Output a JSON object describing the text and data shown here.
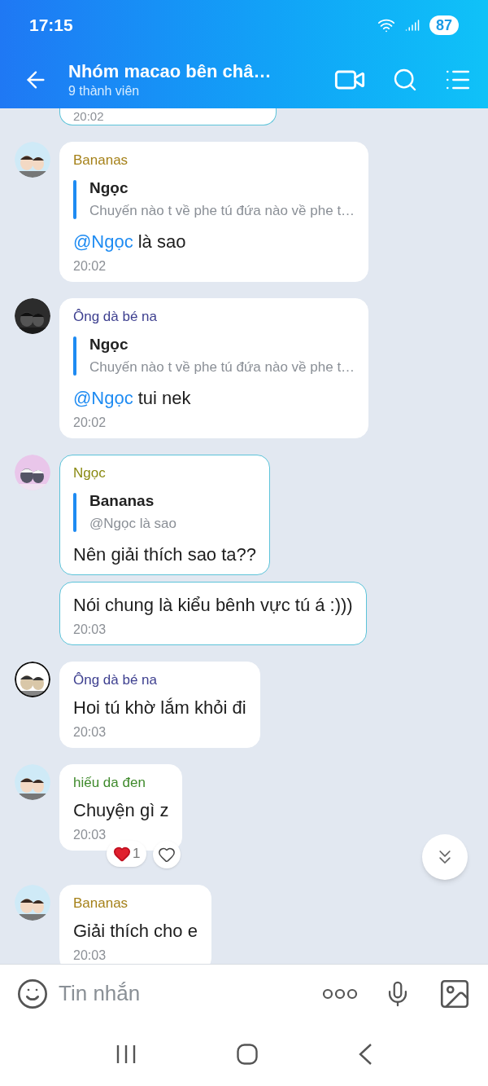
{
  "status_bar": {
    "time": "17:15",
    "battery": "87"
  },
  "header": {
    "title": "Nhóm macao bên châ…",
    "subtitle": "9 thành viên"
  },
  "top_bubble": {
    "time": "20:02"
  },
  "messages": [
    {
      "sender": "Bananas",
      "color": "#a58119",
      "quote": {
        "author": "Ngọc",
        "text": "Chuyến nào t về phe tú đứa nào về phe t…"
      },
      "mention": "@Ngọc",
      "text": "là sao",
      "time": "20:02",
      "highlighted": false
    },
    {
      "sender": "Ông dà bé na",
      "color": "#3d3f8f",
      "quote": {
        "author": "Ngọc",
        "text": "Chuyến nào t về phe tú đứa nào về phe t…"
      },
      "mention": "@Ngọc",
      "text": "tui nek",
      "time": "20:02",
      "highlighted": false
    },
    {
      "sender": "Ngọc",
      "color": "#8a8a12",
      "quote": {
        "author": "Bananas",
        "text": "@Ngọc là sao"
      },
      "text": "Nên giải thích sao ta??",
      "highlighted": true
    },
    {
      "text": "Nói chung là kiểu bênh vực tú á :)))",
      "time": "20:03",
      "highlighted": true
    },
    {
      "sender": "Ông dà bé na",
      "color": "#3d3f8f",
      "text": "Hoi tú khờ lắm khỏi đi",
      "time": "20:03",
      "highlighted": false
    },
    {
      "sender": "hiếu da đen",
      "color": "#3f8a2c",
      "text": "Chuyện gì z",
      "time": "20:03",
      "highlighted": false,
      "reactions": {
        "count": "1"
      }
    },
    {
      "sender": "Bananas",
      "color": "#a58119",
      "text": "Giải thích cho e",
      "time": "20:03",
      "highlighted": false
    }
  ],
  "composer": {
    "placeholder": "Tin nhắn"
  }
}
